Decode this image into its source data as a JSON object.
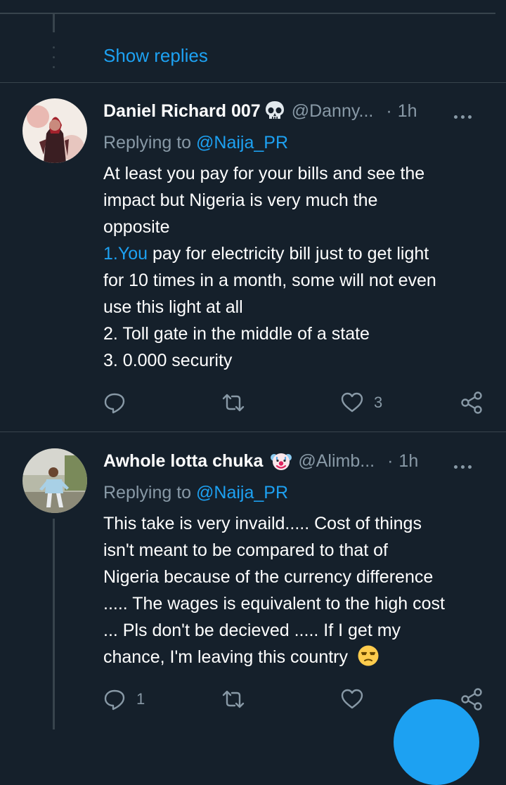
{
  "thread": {
    "show_replies_label": "Show replies"
  },
  "tweets": [
    {
      "name": "Daniel Richard 007",
      "emoji": "skull-emoji",
      "handle": "@Danny...",
      "separator": "·",
      "time": "1h",
      "replying_prefix": "Replying to",
      "replying_handle": "@Naija_PR",
      "lines": [
        "At least you pay for your bills and see the",
        "impact but Nigeria is very much the",
        "opposite",
        {
          "highlight": "1.You",
          "rest": " pay for electricity bill just to get light"
        },
        "for 10 times in a month, some will not even",
        "use this light at all",
        "2. Toll gate in the middle of a state",
        "3. 0.000 security"
      ],
      "reply_count": "",
      "retweet_count": "",
      "like_count": "3"
    },
    {
      "name": "Awhole lotta chuka",
      "emoji": "clown-face-emoji",
      "handle": "@Alimb...",
      "separator": "·",
      "time": "1h",
      "replying_prefix": "Replying to",
      "replying_handle": "@Naija_PR",
      "lines": [
        "This take is very invaild..... Cost of things",
        "isn't meant to be compared to that of",
        "Nigeria because of the currency difference",
        "..... The wages is equivalent to the high cost",
        "...  Pls don't be decieved ..... If I get my",
        "chance, I'm leaving this country"
      ],
      "trailing_emoji": "unamused-face-emoji",
      "reply_count": "1",
      "retweet_count": "",
      "like_count": ""
    }
  ],
  "colors": {
    "background": "#15202b",
    "divider": "#38444d",
    "accent": "#1da1f2",
    "secondary_text": "#8899a6"
  }
}
